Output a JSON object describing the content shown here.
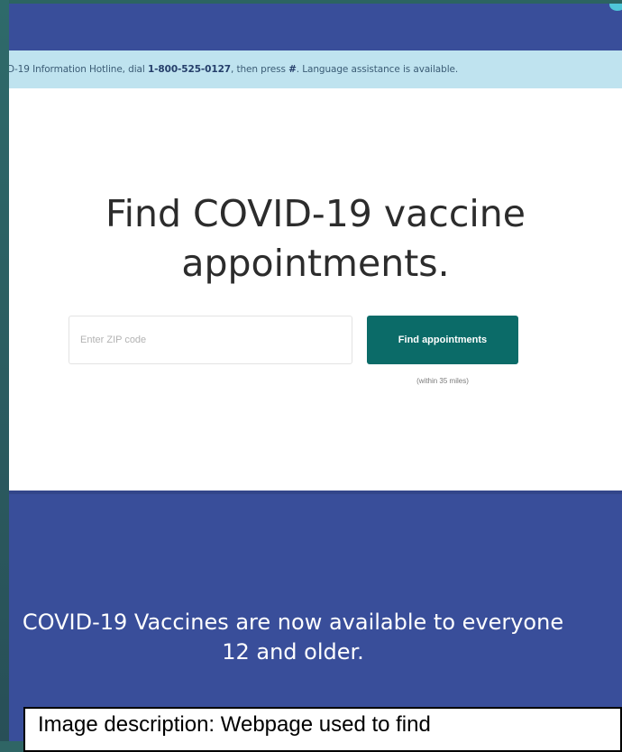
{
  "hotline": {
    "prefix": "D-19 Information Hotline, dial ",
    "phone": "1-800-525-0127",
    "suffix": ", then press ",
    "key": "#",
    "tail": ". Language assistance is available."
  },
  "hero": {
    "title": "Find COVID-19 vaccine appointments.",
    "zip_placeholder": "Enter ZIP code",
    "find_button_label": "Find appointments",
    "radius_note": "(within 35 miles)"
  },
  "banner": {
    "text": "COVID-19 Vaccines are now available to everyone 12 and older."
  },
  "caption": {
    "text": "Image description: Webpage used to find"
  },
  "colors": {
    "header": "#394e9a",
    "hotline_bg": "#bfe3ef",
    "button": "#0b6b68",
    "banner": "#394e9a",
    "frame": "#2f6565"
  }
}
